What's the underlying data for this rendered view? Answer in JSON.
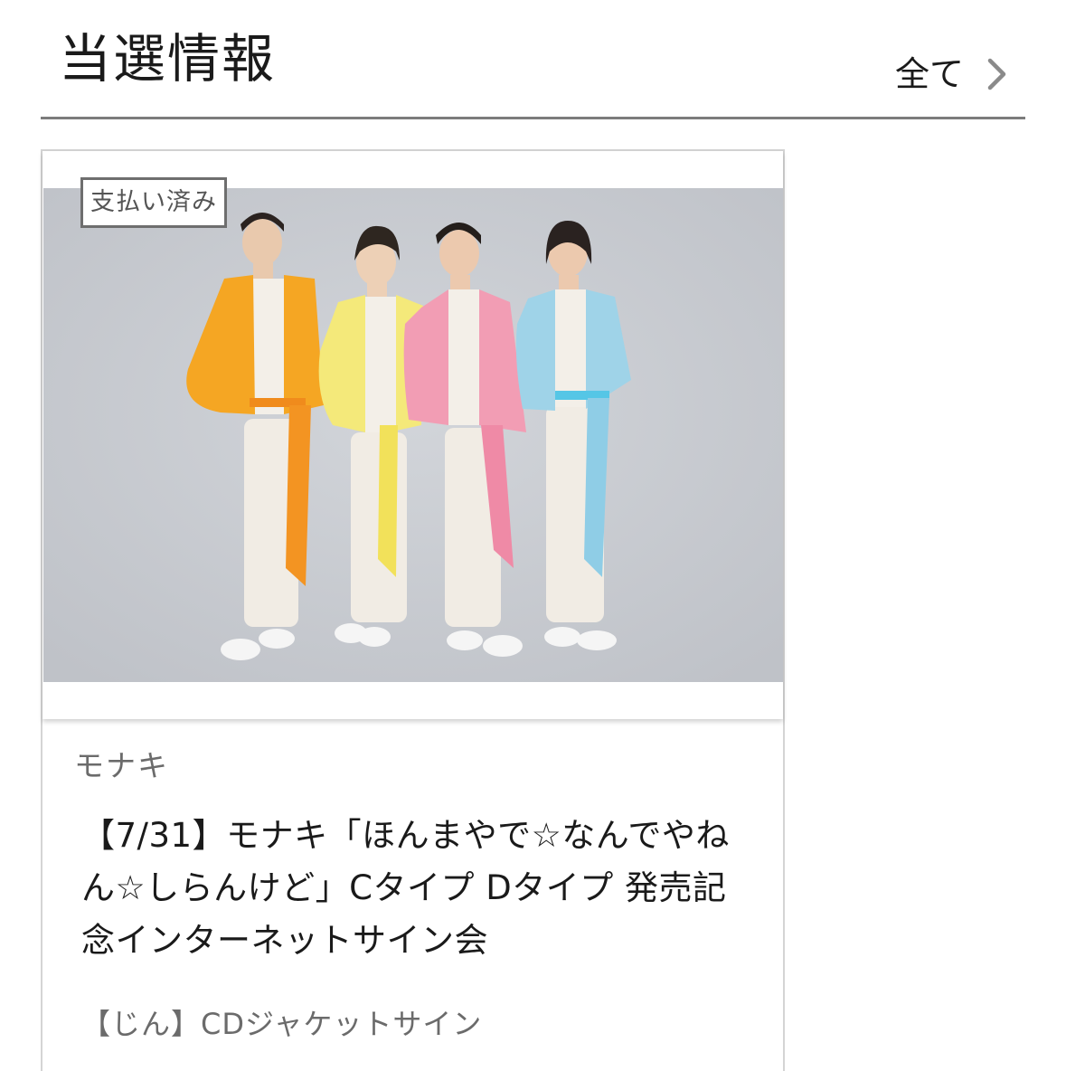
{
  "header": {
    "title": "当選情報",
    "see_all_label": "全て"
  },
  "card": {
    "status_badge": "支払い済み",
    "artist": "モナキ",
    "title": "【7/31】モナキ「ほんまやで☆なんでやねん☆しらんけど」Cタイプ Dタイプ 発売記念インターネットサイン会",
    "item": "【じん】CDジャケットサイン",
    "photo_jacket_colors": [
      "#f5a623",
      "#f4e97a",
      "#f29db4",
      "#9fd3e8"
    ]
  }
}
